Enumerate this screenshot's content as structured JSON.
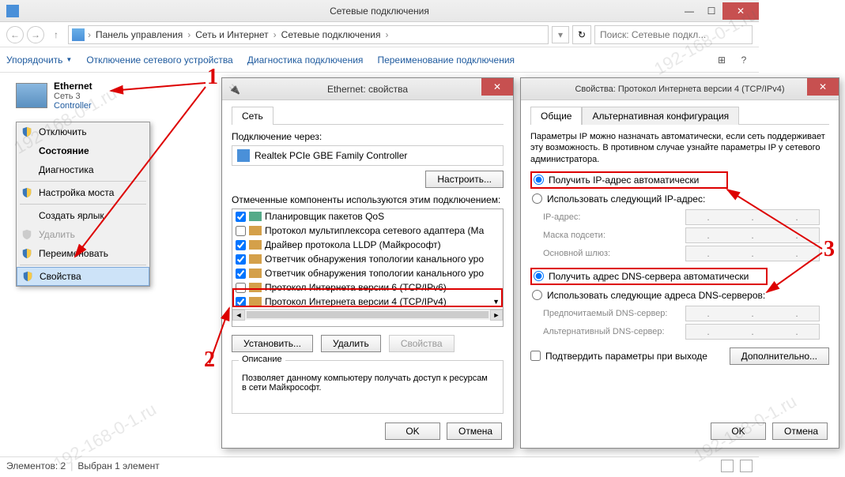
{
  "main": {
    "title": "Сетевые подключения",
    "breadcrumb": [
      "Панель управления",
      "Сеть и Интернет",
      "Сетевые подключения"
    ],
    "search_placeholder": "Поиск: Сетевые подкл...",
    "toolbar": {
      "organize": "Упорядочить",
      "disable": "Отключение сетевого устройства",
      "diagnose": "Диагностика подключения",
      "rename": "Переименование подключения"
    },
    "network": {
      "name": "Ethernet",
      "subnet": "Сеть 3",
      "controller": "Controller"
    },
    "context_menu": {
      "disable": "Отключить",
      "status": "Состояние",
      "diagnose": "Диагностика",
      "bridge": "Настройка моста",
      "shortcut": "Создать ярлык",
      "delete": "Удалить",
      "rename": "Переименовать",
      "properties": "Свойства"
    },
    "status": {
      "count": "Элементов: 2",
      "selected": "Выбран 1 элемент"
    }
  },
  "dlg1": {
    "title": "Ethernet: свойства",
    "tab": "Сеть",
    "conn_label": "Подключение через:",
    "conn_value": "Realtek PCIe GBE Family Controller",
    "configure": "Настроить...",
    "components_label": "Отмеченные компоненты используются этим подключением:",
    "components": [
      {
        "checked": true,
        "label": "Планировщик пакетов QoS"
      },
      {
        "checked": false,
        "label": "Протокол мультиплексора сетевого адаптера (Ма"
      },
      {
        "checked": true,
        "label": "Драйвер протокола LLDP (Майкрософт)"
      },
      {
        "checked": true,
        "label": "Ответчик обнаружения топологии канального уро"
      },
      {
        "checked": true,
        "label": "Ответчик обнаружения топологии канального уро"
      },
      {
        "checked": false,
        "label": "Протокол Интернета версии 6 (TCP/IPv6)"
      },
      {
        "checked": true,
        "label": "Протокол Интернета версии 4 (TCP/IPv4)"
      }
    ],
    "install": "Установить...",
    "remove": "Удалить",
    "props": "Свойства",
    "desc_label": "Описание",
    "desc_text": "Позволяет данному компьютеру получать доступ к ресурсам в сети Майкрософт.",
    "ok": "OK",
    "cancel": "Отмена"
  },
  "dlg2": {
    "title": "Свойства: Протокол Интернета версии 4 (TCP/IPv4)",
    "tab_general": "Общие",
    "tab_alt": "Альтернативная конфигурация",
    "info": "Параметры IP можно назначать автоматически, если сеть поддерживает эту возможность. В противном случае узнайте параметры IP у сетевого администратора.",
    "radio_auto_ip": "Получить IP-адрес автоматически",
    "radio_manual_ip": "Использовать следующий IP-адрес:",
    "ip_label": "IP-адрес:",
    "mask_label": "Маска подсети:",
    "gateway_label": "Основной шлюз:",
    "radio_auto_dns": "Получить адрес DNS-сервера автоматически",
    "radio_manual_dns": "Использовать следующие адреса DNS-серверов:",
    "dns1_label": "Предпочитаемый DNS-сервер:",
    "dns2_label": "Альтернативный DNS-сервер:",
    "confirm_exit": "Подтвердить параметры при выходе",
    "advanced": "Дополнительно...",
    "ok": "OK",
    "cancel": "Отмена"
  },
  "annotations": {
    "n1": "1",
    "n2": "2",
    "n3": "3"
  },
  "watermark": "192-168-0-1.ru"
}
